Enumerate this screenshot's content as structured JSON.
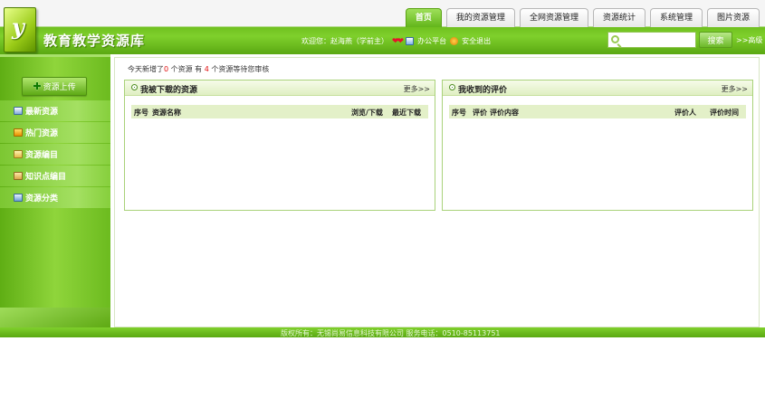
{
  "header": {
    "logo_letter": "y",
    "site_title": "教育教学资源库",
    "tabs": [
      {
        "label": "首页",
        "active": true
      },
      {
        "label": "我的资源管理",
        "active": false
      },
      {
        "label": "全网资源管理",
        "active": false
      },
      {
        "label": "资源统计",
        "active": false
      },
      {
        "label": "系统管理",
        "active": false
      },
      {
        "label": "图片资源",
        "active": false
      }
    ],
    "user_bar": {
      "welcome": "欢迎您：赵海燕（学前主）",
      "hearts": "❤❤",
      "office_link": "办公平台",
      "logout_link": "安全退出"
    },
    "search": {
      "value": "",
      "placeholder": "",
      "button_label": "搜索",
      "advanced_link": ">>高级"
    }
  },
  "sidebar": {
    "upload_label": "资源上传",
    "items": [
      {
        "label": "最新资源",
        "icon": "new-resource-icon"
      },
      {
        "label": "热门资源",
        "icon": "hot-resource-icon"
      },
      {
        "label": "资源编目",
        "icon": "catalog-icon"
      },
      {
        "label": "知识点编目",
        "icon": "knowledge-icon"
      },
      {
        "label": "资源分类",
        "icon": "category-icon"
      }
    ]
  },
  "notice": {
    "prefix": "今天新增了",
    "new_count": "0",
    "middle": " 个资源 有 ",
    "pending_count": "4",
    "suffix": " 个资源等待您审核"
  },
  "panels": {
    "downloads": {
      "title": "我被下载的资源",
      "more": "更多>>",
      "columns": [
        "序号",
        "资源名称",
        "浏览/下载",
        "最近下载"
      ]
    },
    "reviews": {
      "title": "我收到的评价",
      "more": "更多>>",
      "columns": [
        "序号",
        "评价",
        "评价内容",
        "评价人",
        "评价时间"
      ]
    }
  },
  "footer": {
    "text": "版权所有：无锡尚易信息科技有限公司  服务电话：0510-85113751"
  },
  "colors": {
    "brand_green": "#6fc01f",
    "highlight_red": "#e01010"
  }
}
